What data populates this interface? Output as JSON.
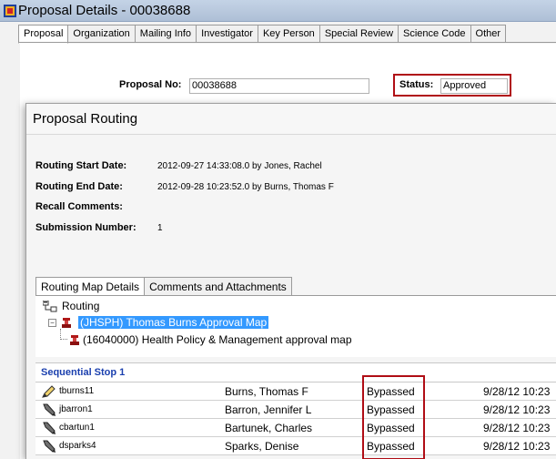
{
  "window": {
    "title": "Proposal Details - 00038688"
  },
  "tabs": [
    "Proposal",
    "Organization",
    "Mailing Info",
    "Investigator",
    "Key Person",
    "Special Review",
    "Science Code",
    "Other"
  ],
  "proposal": {
    "no_label": "Proposal No:",
    "no_value": "00038688",
    "status_label": "Status:",
    "status_value": "Approved"
  },
  "dialog": {
    "title": "Proposal Routing",
    "start_label": "Routing Start Date:",
    "start_value": "2012-09-27 14:33:08.0 by Jones, Rachel",
    "end_label": "Routing End Date:",
    "end_value": "2012-09-28 10:23:52.0 by Burns, Thomas F",
    "recall_label": "Recall Comments:",
    "submission_label": "Submission Number:",
    "submission_value": "1"
  },
  "inner_tabs": [
    "Routing Map Details",
    "Comments and Attachments"
  ],
  "tree": {
    "root": "Routing",
    "node1": "(JHSPH) Thomas Burns Approval Map",
    "node2": "(16040000) Health Policy & Management approval map"
  },
  "stop": {
    "label": "Sequential Stop 1"
  },
  "rows": [
    {
      "user": "tburns11",
      "name": "Burns, Thomas F",
      "action": "Bypassed",
      "time": "9/28/12 10:23",
      "icon": "pencil-icon"
    },
    {
      "user": "jbarron1",
      "name": "Barron, Jennifer L",
      "action": "Bypassed",
      "time": "9/28/12 10:23",
      "icon": "pen-icon"
    },
    {
      "user": "cbartun1",
      "name": "Bartunek, Charles",
      "action": "Bypassed",
      "time": "9/28/12 10:23",
      "icon": "pen-icon"
    },
    {
      "user": "dsparks4",
      "name": "Sparks, Denise",
      "action": "Bypassed",
      "time": "9/28/12 10:23",
      "icon": "pen-icon"
    }
  ],
  "colors": {
    "highlight": "#b00d15",
    "selection": "#3399ff",
    "stop_header": "#1a3fae"
  }
}
